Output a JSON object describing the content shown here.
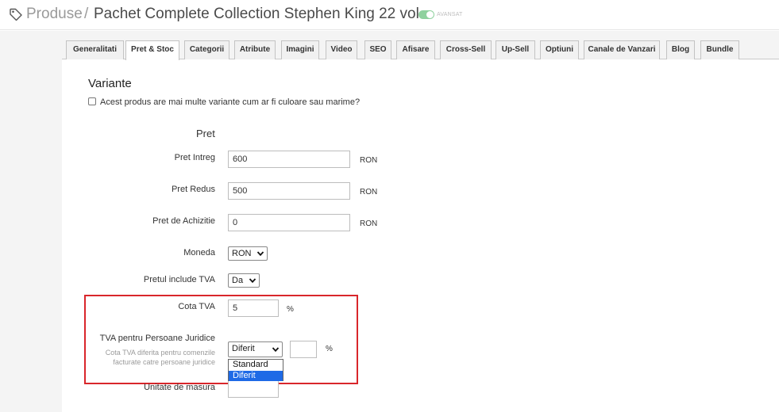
{
  "breadcrumb": {
    "root": "Produse",
    "separator": "/",
    "title": "Pachet Complete Collection Stephen King 22 vol.",
    "toggle_label": "AVANSAT"
  },
  "tabs": [
    {
      "label": "Generalitati",
      "active": false
    },
    {
      "label": "Pret & Stoc",
      "active": true
    },
    {
      "label": "Categorii",
      "active": false
    },
    {
      "label": "Atribute",
      "active": false
    },
    {
      "label": "Imagini",
      "active": false
    },
    {
      "label": "Video",
      "active": false
    },
    {
      "label": "SEO",
      "active": false
    },
    {
      "label": "Afisare",
      "active": false
    },
    {
      "label": "Cross-Sell",
      "active": false
    },
    {
      "label": "Up-Sell",
      "active": false
    },
    {
      "label": "Optiuni",
      "active": false
    },
    {
      "label": "Canale de Vanzari",
      "active": false
    },
    {
      "label": "Blog",
      "active": false
    },
    {
      "label": "Bundle",
      "active": false
    }
  ],
  "variants": {
    "title": "Variante",
    "checkbox_label": "Acest produs are mai multe variante cum ar fi culoare sau marime?",
    "checked": false
  },
  "pret": {
    "group_label": "Pret",
    "pret_intreg": {
      "label": "Pret Intreg",
      "value": "600",
      "unit": "RON"
    },
    "pret_redus": {
      "label": "Pret Redus",
      "value": "500",
      "unit": "RON"
    },
    "pret_achizitie": {
      "label": "Pret de Achizitie",
      "value": "0",
      "unit": "RON"
    },
    "moneda": {
      "label": "Moneda",
      "value": "RON"
    },
    "include_tva": {
      "label": "Pretul include TVA",
      "value": "Da"
    },
    "cota_tva": {
      "label": "Cota TVA",
      "value": "5",
      "unit": "%"
    },
    "tva_pj": {
      "label": "TVA pentru Persoane Juridice",
      "help_line1": "Cota TVA diferita pentru comenzile",
      "help_line2": "facturate catre persoane juridice",
      "value": "Diferit",
      "percent_value": "",
      "unit": "%",
      "options": [
        "Standard",
        "Diferit"
      ],
      "highlighted_option": "Diferit"
    },
    "unitate_masura": {
      "label": "Unitate de masura",
      "value": ""
    }
  },
  "colors": {
    "highlight_border": "#d9262b",
    "toggle_on": "#8fd19e",
    "dropdown_selected": "#1e6ae6"
  }
}
